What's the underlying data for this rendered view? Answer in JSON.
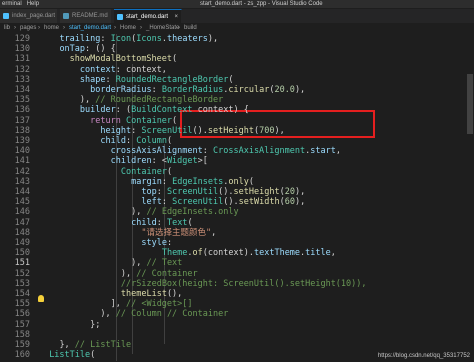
{
  "window": {
    "menu_items": [
      "erminal",
      "Help"
    ],
    "title": "start_demo.dart - zs_zpp - Visual Studio Code"
  },
  "tabs": [
    {
      "label": "index_page.dart",
      "active": false
    },
    {
      "label": "README.md",
      "active": false
    },
    {
      "label": "start_demo.dart",
      "active": true
    }
  ],
  "breadcrumb": [
    "lib",
    "pages",
    "home",
    "start_demo.dart",
    "Home",
    "_HomeState",
    "build"
  ],
  "line_numbers": [
    "129",
    "130",
    "131",
    "132",
    "133",
    "134",
    "135",
    "136",
    "137",
    "138",
    "139",
    "140",
    "141",
    "142",
    "143",
    "144",
    "145",
    "146",
    "147",
    "148",
    "149",
    "150",
    "151",
    "152",
    "153",
    "154",
    "155",
    "156",
    "157",
    "158",
    "159",
    "160"
  ],
  "current_line": "151",
  "colors": {
    "keyword": "#c586c0",
    "property": "#9cdcfe",
    "class": "#4ec9b0",
    "function": "#dcdcaa",
    "string": "#ce9178",
    "number": "#b5cea8",
    "comment": "#6a9955",
    "plain": "#d4d4d4",
    "highlight_box": "#e51f1f"
  },
  "watermark": "https://blog.csdn.net/qq_35317752"
}
